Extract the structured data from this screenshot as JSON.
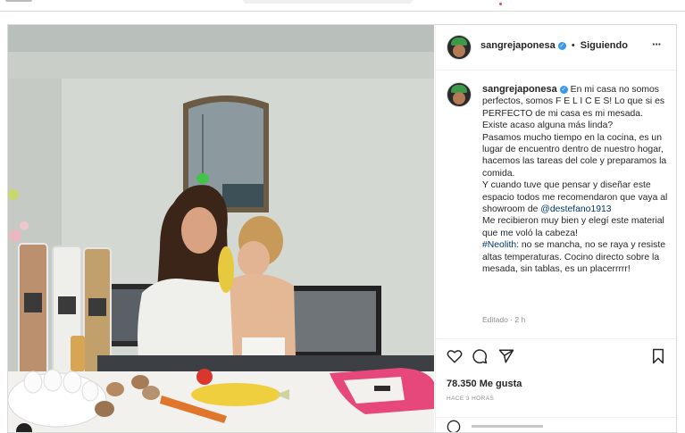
{
  "post": {
    "username": "sangrejaponesa",
    "follow_status": "Siguiendo",
    "separator": "•",
    "more_label": "···",
    "caption_lines": [
      {
        "text": "En mi casa no somos perfectos, somos F E L I C E S! Lo que si es PERFECTO de mi casa es mi mesada. Existe acaso alguna más linda?"
      },
      {
        "text": "Pasamos mucho tiempo en la cocina, es un lugar de encuentro dentro de nuestro hogar, hacemos las tareas del cole y preparamos la comida."
      },
      {
        "pre": "Y cuando tuve que pensar y diseñar este espacio todos me recomendaron que vaya al showroom de ",
        "mention": "@destefano1913"
      },
      {
        "text": "Me recibieron muy bien y elegí este material que me voló la cabeza!"
      },
      {
        "hashtag": "#Neolith",
        "post": ": no se mancha, no se raya y resiste altas temperaturas. Cocino directo sobre la mesada, sin tablas, es un placerrrrr!"
      }
    ],
    "edited": "Editado · 2 h",
    "likes": "78.350 Me gusta",
    "time_ago": "HACE 3 HORAS"
  },
  "colors": {
    "verified": "#3897f0",
    "link": "#00376b",
    "border": "#dbdbdb",
    "muted": "#8e8e8e"
  },
  "icons": [
    "heart-icon",
    "comment-icon",
    "share-icon",
    "bookmark-icon",
    "more-icon",
    "emoji-icon"
  ]
}
